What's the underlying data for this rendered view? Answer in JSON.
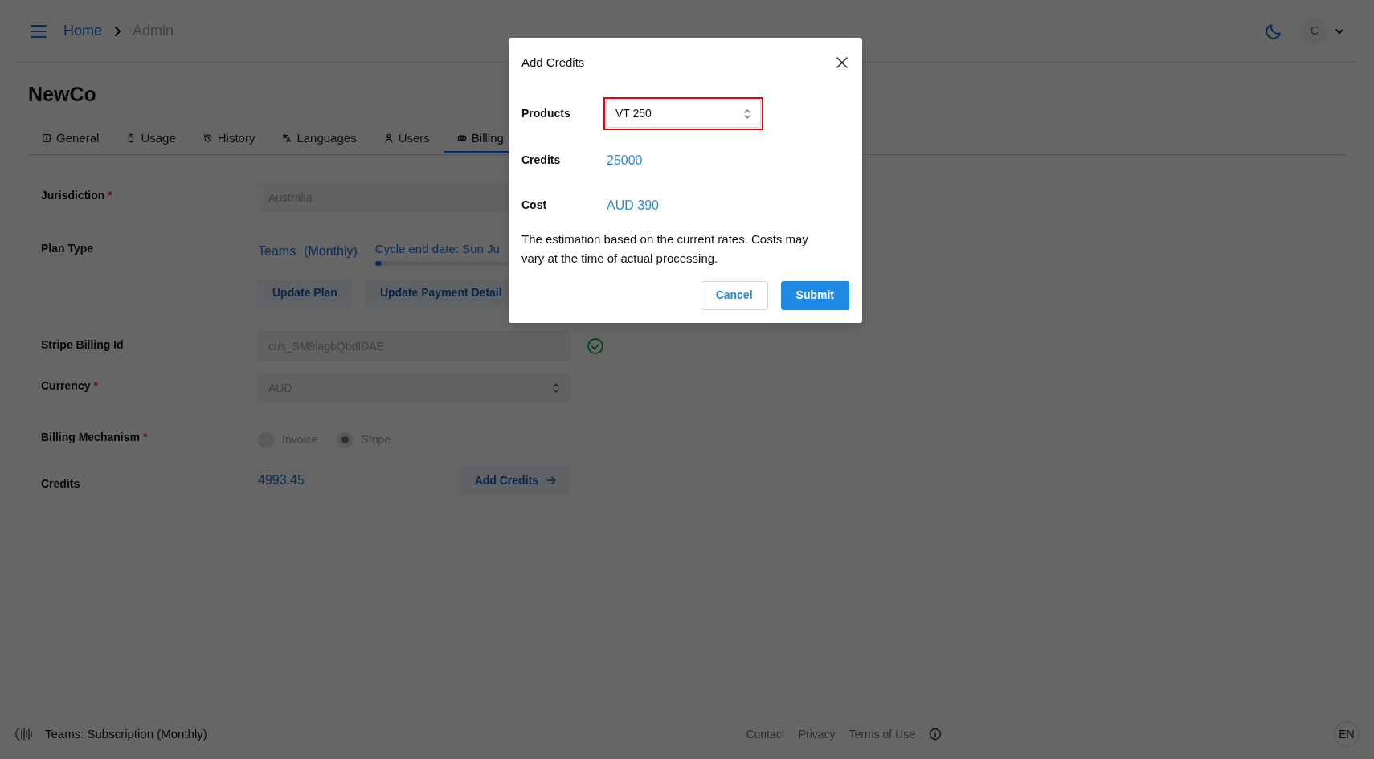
{
  "header": {
    "breadcrumbs": [
      {
        "label": "Home",
        "current": false
      },
      {
        "label": "Admin",
        "current": true
      }
    ],
    "user_initial": "C"
  },
  "page_title": "NewCo",
  "tabs": [
    {
      "label": "General",
      "selected": false
    },
    {
      "label": "Usage",
      "selected": false
    },
    {
      "label": "History",
      "selected": false
    },
    {
      "label": "Languages",
      "selected": false
    },
    {
      "label": "Users",
      "selected": false
    },
    {
      "label": "Billing",
      "selected": true
    }
  ],
  "form": {
    "jurisdiction": {
      "label": "Jurisdiction",
      "required_mark": "*",
      "value": "Australia"
    },
    "plan_type": {
      "label": "Plan Type",
      "plan": "Teams",
      "period": "(Monthly)",
      "cycle_text": "Cycle end date: Sun Ju",
      "cycle_level": {
        "level": 0.04
      },
      "buttons": [
        "Update Plan",
        "Update Payment Detail"
      ]
    },
    "stripe_billing_id": {
      "label": "Stripe Billing Id",
      "value": "cus_SM9lagbQbdIDAE",
      "verified": true
    },
    "currency": {
      "label": "Currency",
      "required_mark": "*",
      "value": "AUD"
    },
    "billing_mechanism": {
      "label": "Billing Mechanism",
      "required_mark": "*",
      "options": [
        {
          "label": "Invoice",
          "selected": false
        },
        {
          "label": "Stripe",
          "selected": true
        }
      ]
    },
    "credits": {
      "label": "Credits",
      "value": "4993.45",
      "button": "Add Credits"
    }
  },
  "modal": {
    "title": "Add Credits",
    "fields": [
      {
        "kind": "select",
        "label": "Products",
        "value": "VT 250",
        "highlighted": true
      },
      {
        "kind": "value",
        "label": "Credits",
        "value": "25000"
      },
      {
        "kind": "value",
        "label": "Cost",
        "value": "AUD 390"
      }
    ],
    "note": "The estimation based on the current rates. Costs may vary at the time of actual processing.",
    "buttons": [
      {
        "kind": "secondary",
        "label": "Cancel"
      },
      {
        "kind": "primary",
        "label": "Submit"
      }
    ]
  },
  "footer": {
    "plan_text": "Teams: Subscription (Monthly)",
    "links": [
      "Contact",
      "Privacy",
      "Terms of Use"
    ],
    "language": "EN"
  }
}
